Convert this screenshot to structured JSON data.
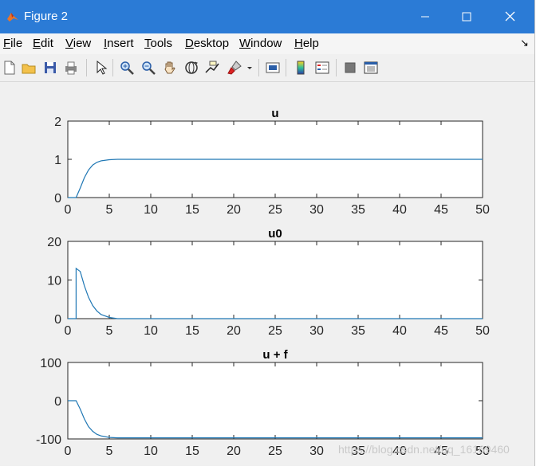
{
  "window": {
    "title": "Figure 2"
  },
  "menu": {
    "items": [
      {
        "label": "File",
        "hot": "F",
        "rest": "ile"
      },
      {
        "label": "Edit",
        "hot": "E",
        "rest": "dit"
      },
      {
        "label": "View",
        "hot": "V",
        "rest": "iew"
      },
      {
        "label": "Insert",
        "hot": "I",
        "rest": "nsert"
      },
      {
        "label": "Tools",
        "hot": "T",
        "rest": "ools"
      },
      {
        "label": "Desktop",
        "hot": "D",
        "rest": "esktop"
      },
      {
        "label": "Window",
        "hot": "W",
        "rest": "indow"
      },
      {
        "label": "Help",
        "hot": "H",
        "rest": "elp"
      }
    ]
  },
  "toolbar": {
    "icons": [
      "new-figure-icon",
      "open-file-icon",
      "save-icon",
      "print-icon",
      "pointer-icon",
      "zoom-in-icon",
      "zoom-out-icon",
      "pan-hand-icon",
      "rotate-3d-icon",
      "data-cursor-icon",
      "brush-icon",
      "link-plot-icon",
      "insert-colorbar-icon",
      "insert-legend-icon",
      "hide-plot-tools-icon",
      "show-plot-tools-icon"
    ]
  },
  "colors": {
    "titlebar": "#2b7bd6",
    "line": "#1f77b4"
  },
  "chart_data": [
    {
      "type": "line",
      "title": "u",
      "xlim": [
        0,
        50
      ],
      "ylim": [
        0,
        2
      ],
      "xticks": [
        0,
        5,
        10,
        15,
        20,
        25,
        30,
        35,
        40,
        45,
        50
      ],
      "yticks": [
        0,
        1,
        2
      ],
      "series": [
        {
          "x": [
            0,
            1,
            1.5,
            2,
            2.5,
            3,
            3.5,
            4,
            5,
            6,
            8,
            50
          ],
          "y": [
            0,
            0,
            0.25,
            0.52,
            0.72,
            0.85,
            0.92,
            0.96,
            0.99,
            1,
            1,
            1
          ]
        }
      ]
    },
    {
      "type": "line",
      "title": "u0",
      "xlim": [
        0,
        50
      ],
      "ylim": [
        0,
        20
      ],
      "xticks": [
        0,
        5,
        10,
        15,
        20,
        25,
        30,
        35,
        40,
        45,
        50
      ],
      "yticks": [
        0,
        10,
        20
      ],
      "series": [
        {
          "x": [
            0,
            0.9,
            1,
            1,
            1.5,
            2,
            2.5,
            3,
            3.5,
            4,
            5,
            6,
            50
          ],
          "y": [
            0,
            0,
            0,
            13,
            12.2,
            8.5,
            5.5,
            3.4,
            2,
            1.1,
            0.3,
            0,
            0
          ]
        }
      ]
    },
    {
      "type": "line",
      "title": "u + f",
      "xlim": [
        0,
        50
      ],
      "ylim": [
        -100,
        100
      ],
      "xticks": [
        0,
        5,
        10,
        15,
        20,
        25,
        30,
        35,
        40,
        45,
        50
      ],
      "yticks": [
        -100,
        0,
        100
      ],
      "series": [
        {
          "x": [
            0,
            1,
            1.5,
            2,
            2.5,
            3,
            3.5,
            4,
            5,
            6,
            8,
            50
          ],
          "y": [
            0,
            0,
            -22,
            -48,
            -68,
            -80,
            -88,
            -92,
            -96,
            -97,
            -97,
            -97
          ]
        }
      ]
    }
  ],
  "watermark": "https://blog.csdn.net/qq_16169460"
}
